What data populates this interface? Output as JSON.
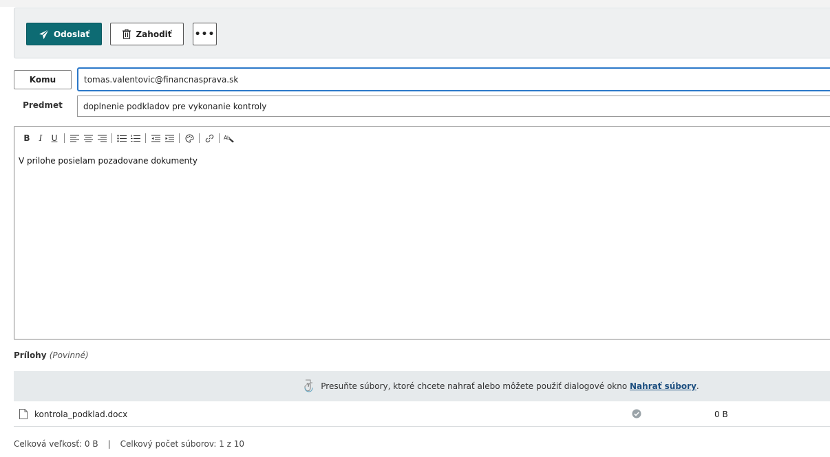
{
  "toolbar": {
    "send_label": "Odoslať",
    "discard_label": "Zahodiť",
    "more_label": "•••"
  },
  "to": {
    "button_label": "Komu",
    "value": "tomas.valentovic@financnasprava.sk"
  },
  "subject": {
    "label": "Predmet",
    "value": "doplnenie podkladov pre vykonanie kontroly"
  },
  "editor": {
    "toolbar": [
      "bold",
      "italic",
      "underline",
      "align-left",
      "align-center",
      "align-right",
      "bulleted-list",
      "numbered-list",
      "outdent",
      "indent",
      "color",
      "link",
      "spellcheck"
    ],
    "body": "V prilohe posielam pozadovane dokumenty"
  },
  "attachments": {
    "label": "Prílohy",
    "required_note": "(Povinné)",
    "drop_text": "Presuňte súbory, ktoré chcete nahrať alebo môžete použiť dialogové okno",
    "upload_link": "Nahrať súbory",
    "drop_text_end": ".",
    "files": [
      {
        "name": "kontrola_podklad.docx",
        "size": "0 B",
        "status": "uploaded"
      }
    ],
    "total_size": "Celková veľkosť: 0 B",
    "total_count": "Celkový počet súborov: 1 z 10",
    "divider": "|"
  },
  "colors": {
    "primary": "#0d6b73",
    "focus_border": "#2b78c9",
    "link": "#1d4f80"
  }
}
